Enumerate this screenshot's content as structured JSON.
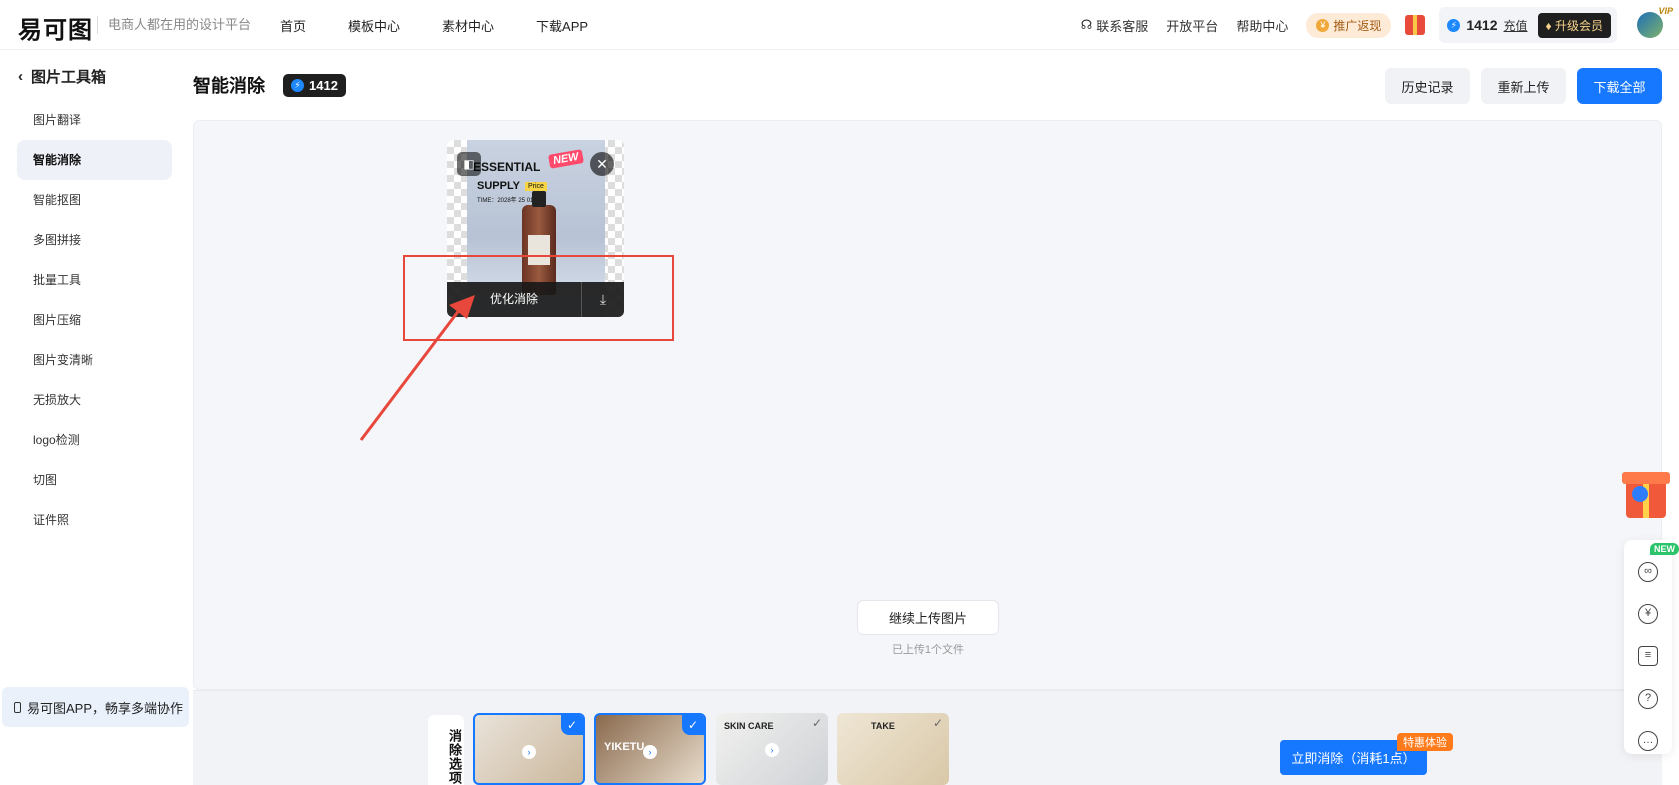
{
  "header": {
    "logo": "易可图",
    "slogan": "电商人都在用的设计平台",
    "nav": [
      "首页",
      "模板中心",
      "素材中心",
      "下载APP"
    ],
    "customer_service": "联系客服",
    "open_platform": "开放平台",
    "help_center": "帮助中心",
    "promo": "推广返现",
    "points": "1412",
    "recharge": "充值",
    "upgrade": "升级会员",
    "vip_tag": "VIP"
  },
  "sidebar": {
    "title": "图片工具箱",
    "items": [
      "图片翻译",
      "智能消除",
      "智能抠图",
      "多图拼接",
      "批量工具",
      "图片压缩",
      "图片变清晰",
      "无损放大",
      "logo检测",
      "切图",
      "证件照"
    ],
    "active_index": 1,
    "app_banner": "易可图APP，畅享多端协作"
  },
  "main": {
    "title": "智能消除",
    "points": "1412",
    "history": "历史记录",
    "reupload": "重新上传",
    "download_all": "下载全部",
    "thumb": {
      "poster_line1": "ESSENTIAL",
      "poster_line2": "SUPPLY",
      "poster_new": "NEW",
      "poster_price": "Price",
      "poster_time": "TIME：2028年 25 01,18",
      "optimize": "优化消除",
      "compare_icon": "◧",
      "close_icon": "✕",
      "download_icon": "⤓"
    },
    "continue_upload": "继续上传图片",
    "uploaded_note": "已上传1个文件"
  },
  "bottom": {
    "options_label": "消除选项",
    "options": [
      {
        "caption": "",
        "selected": true
      },
      {
        "caption": "YIKETU",
        "selected": true
      },
      {
        "caption": "SKIN CARE",
        "selected": false
      },
      {
        "caption": "TAKE",
        "selected": false
      }
    ],
    "start": "立即消除（消耗1点）",
    "trial": "特惠体验"
  },
  "float": {
    "new_tag": "NEW",
    "tools": [
      "link-icon",
      "yuan-icon",
      "note-icon",
      "help-icon",
      "chat-icon"
    ]
  },
  "colors": {
    "accent": "#1677ff",
    "highlight": "#e8473c"
  }
}
